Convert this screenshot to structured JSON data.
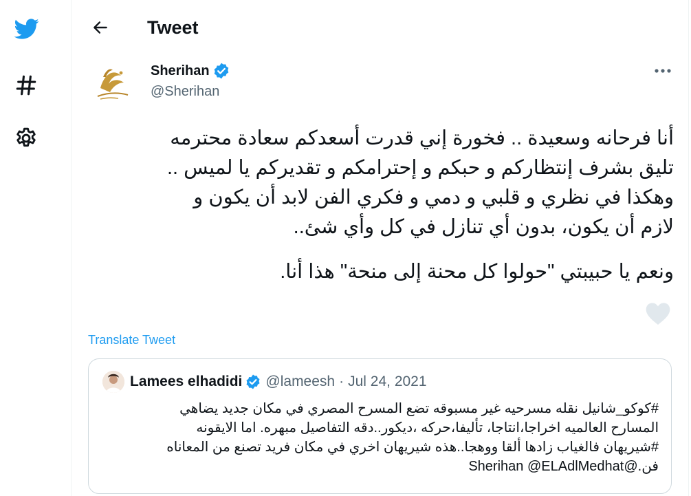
{
  "header": {
    "title": "Tweet"
  },
  "tweet": {
    "author": {
      "name": "Sherihan",
      "handle": "@Sherihan"
    },
    "lines": [
      "أنا فرحانه وسعيدة .. فخورة إني قدرت أسعدكم سعادة محترمه",
      "تليق بشرف إنتظاركم و حبكم و إحترامكم و تقديركم يا لميس ..",
      "وهكذا في نظري و قلبي و دمي و فكري الفن لابد أن يكون و",
      "لازم أن يكون، بدون أي تنازل في كل وأي شئ..",
      "ونعم يا حبيبتي \"حولوا كل محنة إلى منحة\" هذا أنا."
    ],
    "translate_label": "Translate Tweet"
  },
  "quote": {
    "name": "Lamees elhadidi",
    "handle": "@lameesh",
    "separator": "·",
    "date": "Jul 24, 2021",
    "lines": [
      "#كوكو_شانيل نقله مسرحيه غير مسبوقه تضع المسرح المصري في مكان جديد يضاهي",
      "المسارح العالميه اخراجا،انتاجا، تأليفا،حركه ،ديكور..دقه التفاصيل مبهره. اما الايقونه",
      "#شيريهان فالغياب زادها ألقا ووهجا..هذه شيريهان اخري في مكان فريد تصنع من المعاناه",
      "فن.@Sherihan @ELAdlMedhat"
    ]
  },
  "colors": {
    "brand": "#1d9bf0",
    "muted": "#536471",
    "border": "#cfd9de"
  },
  "icons": {
    "nav": [
      "twitter-bird-icon",
      "hashtag-icon",
      "gear-icon"
    ],
    "other": [
      "back-arrow-icon",
      "verified-badge-icon",
      "more-icon",
      "heart-icon"
    ]
  }
}
